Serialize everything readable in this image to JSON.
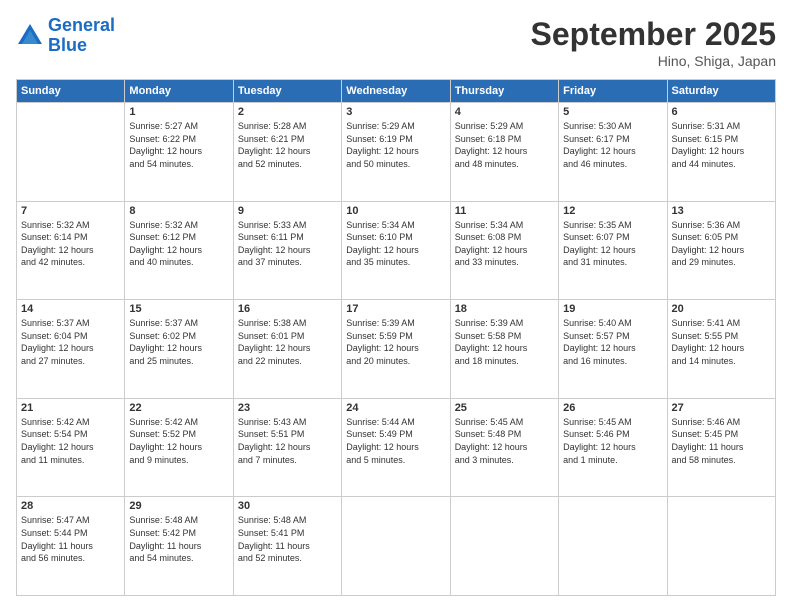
{
  "logo": {
    "line1": "General",
    "line2": "Blue"
  },
  "header": {
    "month": "September 2025",
    "location": "Hino, Shiga, Japan"
  },
  "weekdays": [
    "Sunday",
    "Monday",
    "Tuesday",
    "Wednesday",
    "Thursday",
    "Friday",
    "Saturday"
  ],
  "weeks": [
    [
      {
        "day": "",
        "info": ""
      },
      {
        "day": "1",
        "info": "Sunrise: 5:27 AM\nSunset: 6:22 PM\nDaylight: 12 hours\nand 54 minutes."
      },
      {
        "day": "2",
        "info": "Sunrise: 5:28 AM\nSunset: 6:21 PM\nDaylight: 12 hours\nand 52 minutes."
      },
      {
        "day": "3",
        "info": "Sunrise: 5:29 AM\nSunset: 6:19 PM\nDaylight: 12 hours\nand 50 minutes."
      },
      {
        "day": "4",
        "info": "Sunrise: 5:29 AM\nSunset: 6:18 PM\nDaylight: 12 hours\nand 48 minutes."
      },
      {
        "day": "5",
        "info": "Sunrise: 5:30 AM\nSunset: 6:17 PM\nDaylight: 12 hours\nand 46 minutes."
      },
      {
        "day": "6",
        "info": "Sunrise: 5:31 AM\nSunset: 6:15 PM\nDaylight: 12 hours\nand 44 minutes."
      }
    ],
    [
      {
        "day": "7",
        "info": "Sunrise: 5:32 AM\nSunset: 6:14 PM\nDaylight: 12 hours\nand 42 minutes."
      },
      {
        "day": "8",
        "info": "Sunrise: 5:32 AM\nSunset: 6:12 PM\nDaylight: 12 hours\nand 40 minutes."
      },
      {
        "day": "9",
        "info": "Sunrise: 5:33 AM\nSunset: 6:11 PM\nDaylight: 12 hours\nand 37 minutes."
      },
      {
        "day": "10",
        "info": "Sunrise: 5:34 AM\nSunset: 6:10 PM\nDaylight: 12 hours\nand 35 minutes."
      },
      {
        "day": "11",
        "info": "Sunrise: 5:34 AM\nSunset: 6:08 PM\nDaylight: 12 hours\nand 33 minutes."
      },
      {
        "day": "12",
        "info": "Sunrise: 5:35 AM\nSunset: 6:07 PM\nDaylight: 12 hours\nand 31 minutes."
      },
      {
        "day": "13",
        "info": "Sunrise: 5:36 AM\nSunset: 6:05 PM\nDaylight: 12 hours\nand 29 minutes."
      }
    ],
    [
      {
        "day": "14",
        "info": "Sunrise: 5:37 AM\nSunset: 6:04 PM\nDaylight: 12 hours\nand 27 minutes."
      },
      {
        "day": "15",
        "info": "Sunrise: 5:37 AM\nSunset: 6:02 PM\nDaylight: 12 hours\nand 25 minutes."
      },
      {
        "day": "16",
        "info": "Sunrise: 5:38 AM\nSunset: 6:01 PM\nDaylight: 12 hours\nand 22 minutes."
      },
      {
        "day": "17",
        "info": "Sunrise: 5:39 AM\nSunset: 5:59 PM\nDaylight: 12 hours\nand 20 minutes."
      },
      {
        "day": "18",
        "info": "Sunrise: 5:39 AM\nSunset: 5:58 PM\nDaylight: 12 hours\nand 18 minutes."
      },
      {
        "day": "19",
        "info": "Sunrise: 5:40 AM\nSunset: 5:57 PM\nDaylight: 12 hours\nand 16 minutes."
      },
      {
        "day": "20",
        "info": "Sunrise: 5:41 AM\nSunset: 5:55 PM\nDaylight: 12 hours\nand 14 minutes."
      }
    ],
    [
      {
        "day": "21",
        "info": "Sunrise: 5:42 AM\nSunset: 5:54 PM\nDaylight: 12 hours\nand 11 minutes."
      },
      {
        "day": "22",
        "info": "Sunrise: 5:42 AM\nSunset: 5:52 PM\nDaylight: 12 hours\nand 9 minutes."
      },
      {
        "day": "23",
        "info": "Sunrise: 5:43 AM\nSunset: 5:51 PM\nDaylight: 12 hours\nand 7 minutes."
      },
      {
        "day": "24",
        "info": "Sunrise: 5:44 AM\nSunset: 5:49 PM\nDaylight: 12 hours\nand 5 minutes."
      },
      {
        "day": "25",
        "info": "Sunrise: 5:45 AM\nSunset: 5:48 PM\nDaylight: 12 hours\nand 3 minutes."
      },
      {
        "day": "26",
        "info": "Sunrise: 5:45 AM\nSunset: 5:46 PM\nDaylight: 12 hours\nand 1 minute."
      },
      {
        "day": "27",
        "info": "Sunrise: 5:46 AM\nSunset: 5:45 PM\nDaylight: 11 hours\nand 58 minutes."
      }
    ],
    [
      {
        "day": "28",
        "info": "Sunrise: 5:47 AM\nSunset: 5:44 PM\nDaylight: 11 hours\nand 56 minutes."
      },
      {
        "day": "29",
        "info": "Sunrise: 5:48 AM\nSunset: 5:42 PM\nDaylight: 11 hours\nand 54 minutes."
      },
      {
        "day": "30",
        "info": "Sunrise: 5:48 AM\nSunset: 5:41 PM\nDaylight: 11 hours\nand 52 minutes."
      },
      {
        "day": "",
        "info": ""
      },
      {
        "day": "",
        "info": ""
      },
      {
        "day": "",
        "info": ""
      },
      {
        "day": "",
        "info": ""
      }
    ]
  ]
}
